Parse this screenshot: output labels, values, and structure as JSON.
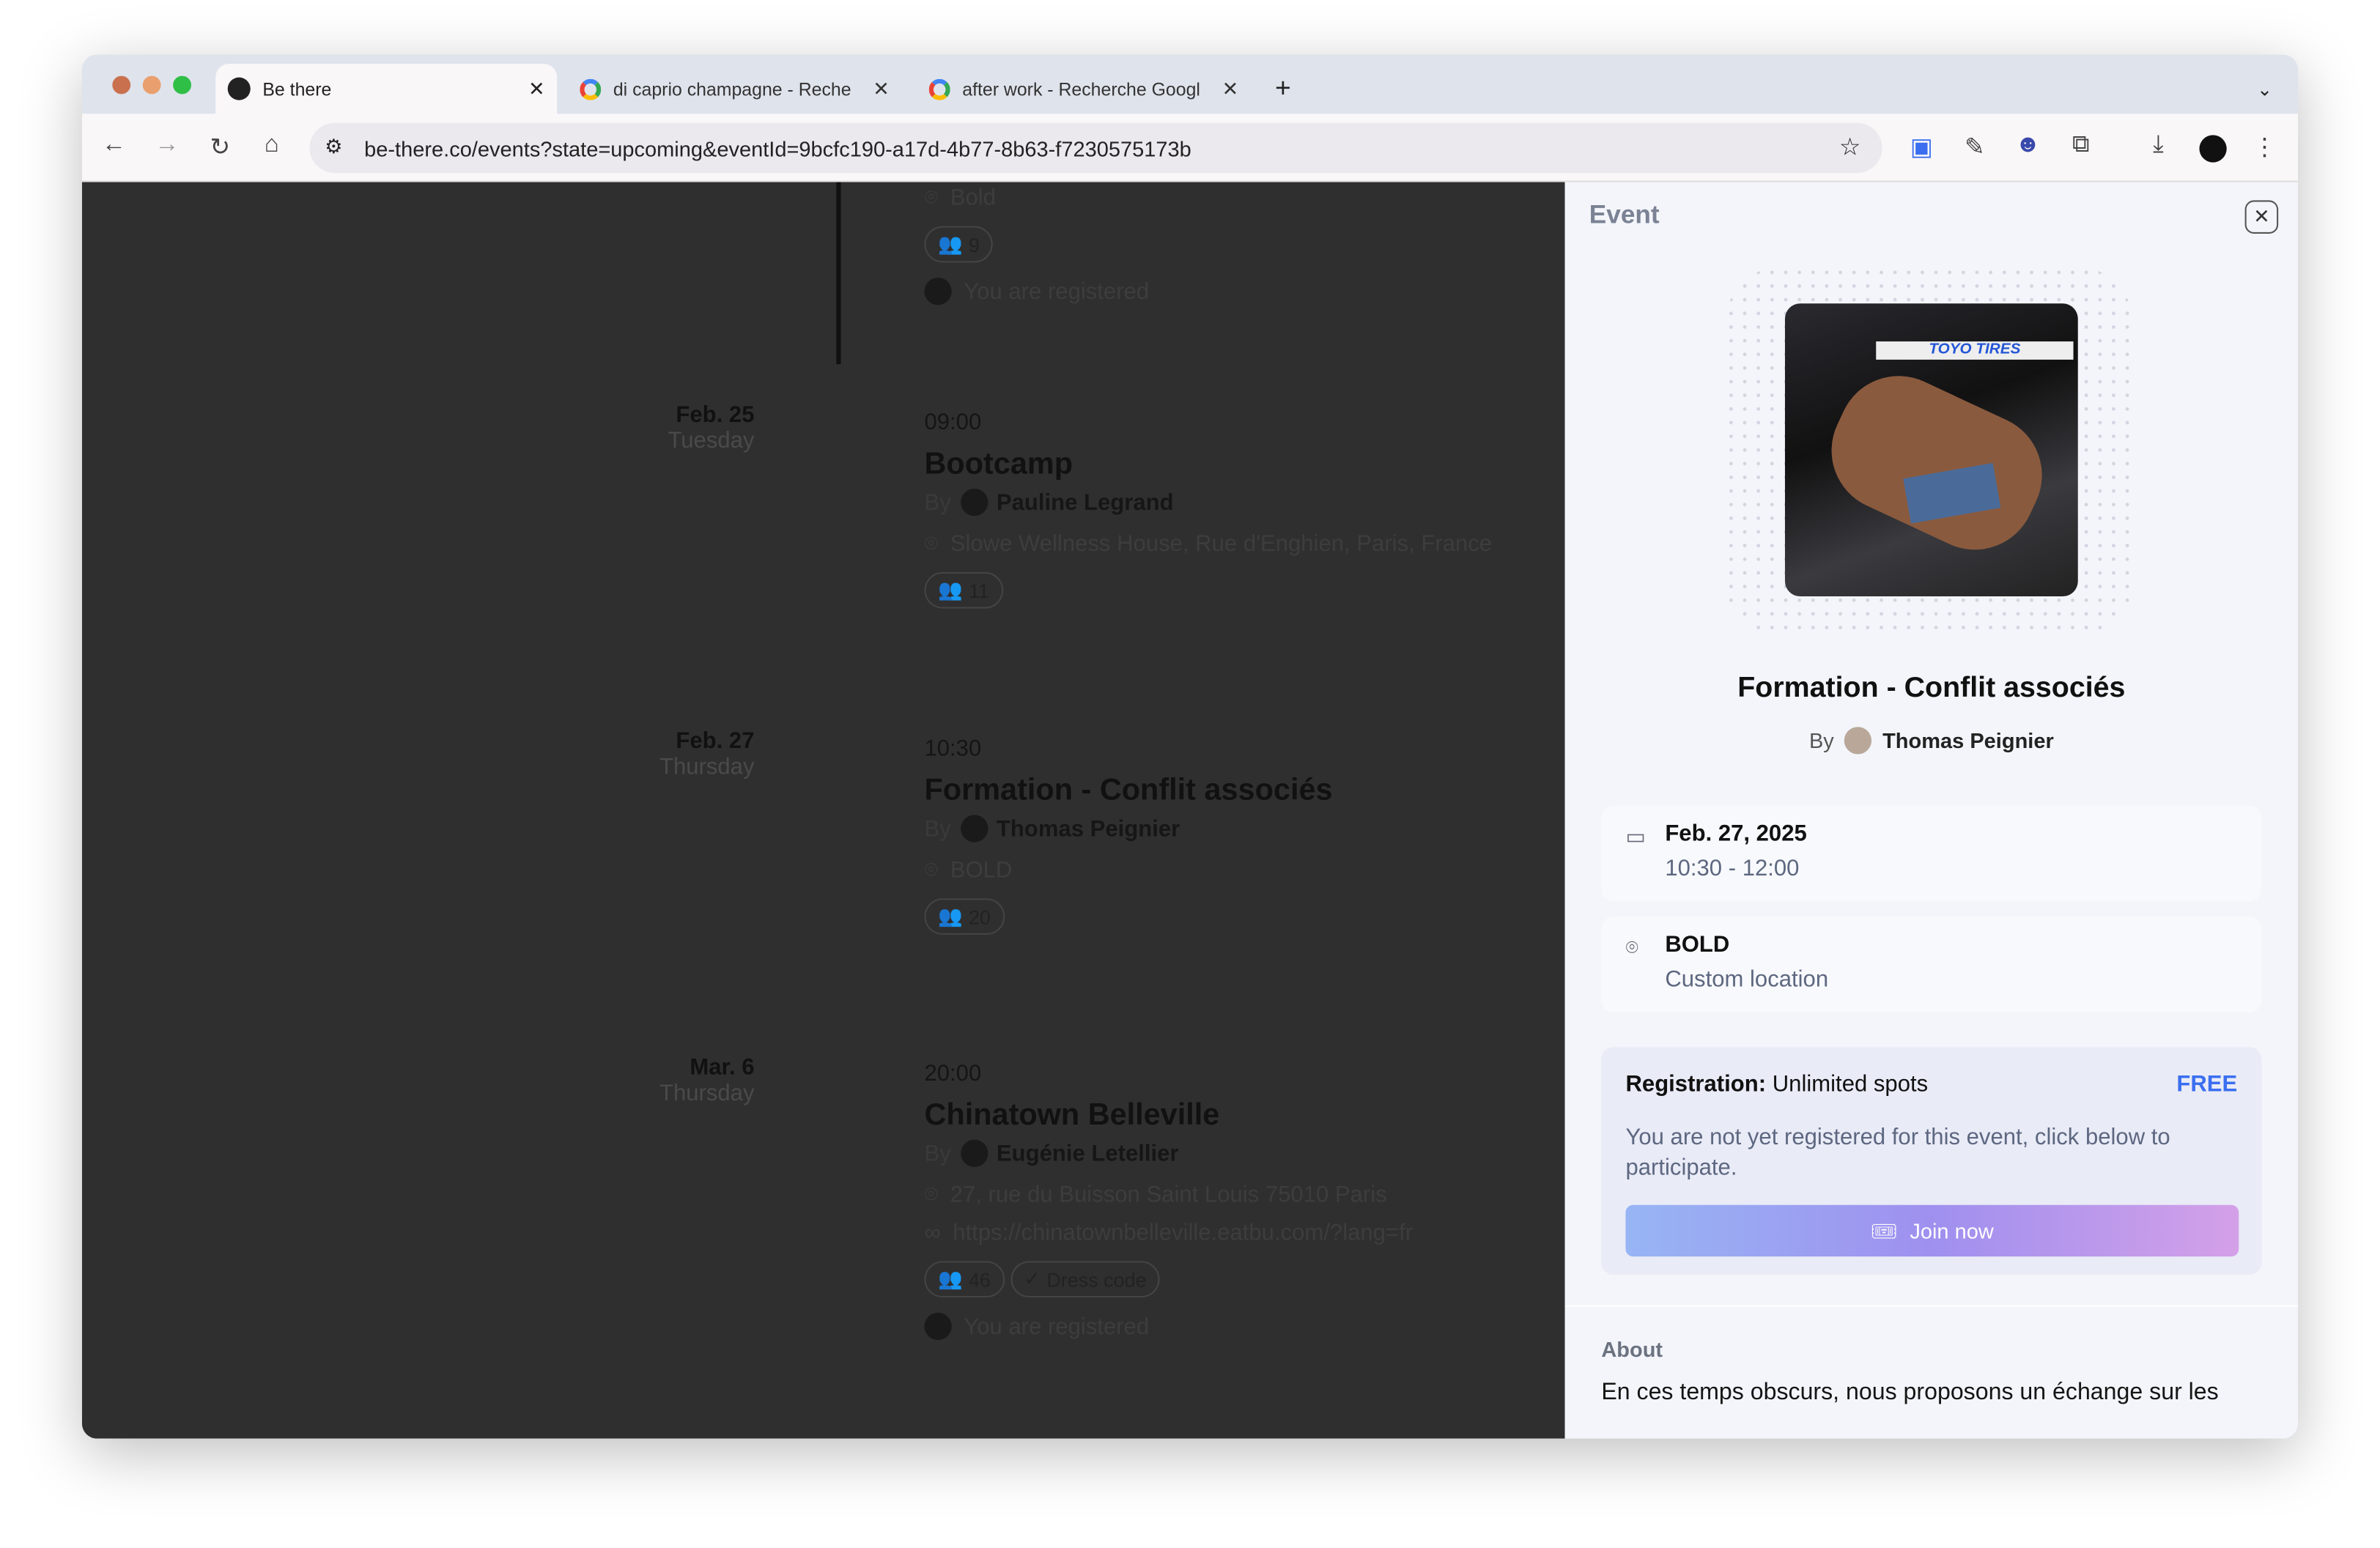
{
  "browser": {
    "tabs": [
      {
        "title": "Be there",
        "active": true
      },
      {
        "title": "di caprio champagne - Reche",
        "active": false
      },
      {
        "title": "after work - Recherche Googl",
        "active": false
      }
    ],
    "url": "be-there.co/events?state=upcoming&eventId=9bcfc190-a17d-4b77-8b63-f7230575173b"
  },
  "events_list": {
    "top_partial": {
      "location": "Bold",
      "attendees": "9",
      "registered": "You are registered"
    },
    "items": [
      {
        "date": "Feb. 25",
        "weekday": "Tuesday",
        "time": "09:00",
        "title": "Bootcamp",
        "by": "By",
        "organizer": "Pauline Legrand",
        "location": "Slowe Wellness House, Rue d'Enghien, Paris, France",
        "attendees": "11"
      },
      {
        "date": "Feb. 27",
        "weekday": "Thursday",
        "time": "10:30",
        "title": "Formation - Conflit associés",
        "by": "By",
        "organizer": "Thomas Peignier",
        "location": "BOLD",
        "attendees": "20"
      },
      {
        "date": "Mar. 6",
        "weekday": "Thursday",
        "time": "20:00",
        "title": "Chinatown Belleville",
        "by": "By",
        "organizer": "Eugénie Letellier",
        "location": "27, rue du Buisson Saint Louis 75010 Paris",
        "link": "https://chinatownbelleville.eatbu.com/?lang=fr",
        "attendees": "46",
        "tag": "Dress code",
        "registered": "You are registered"
      }
    ]
  },
  "panel": {
    "header": "Event",
    "title": "Formation - Conflit associés",
    "by": "By",
    "organizer": "Thomas Peignier",
    "image_text": "TOYO TIRES",
    "date": "Feb. 27, 2025",
    "time": "10:30 - 12:00",
    "location": "BOLD",
    "location_sub": "Custom location",
    "registration_label": "Registration:",
    "registration_value": "Unlimited spots",
    "price": "FREE",
    "notice": "You are not yet registered for this event, click below to participate.",
    "join_label": "Join now",
    "about_label": "About",
    "about_text": "En ces temps obscurs, nous proposons un échange sur les"
  },
  "colors": {
    "accent": "#3b6ff0",
    "overlay": "#2f2f30"
  }
}
